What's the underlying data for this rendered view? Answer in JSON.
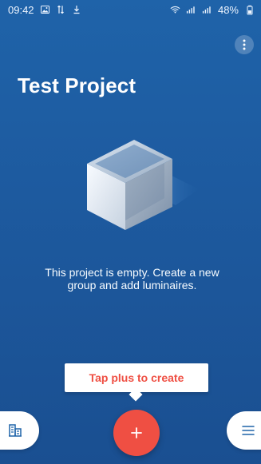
{
  "status_bar": {
    "time": "09:42",
    "battery": "48%"
  },
  "project": {
    "title": "Test Project",
    "empty_message": "This project is empty. Create a new group and add luminaires."
  },
  "actions": {
    "tooltip": "Tap plus to create",
    "more_icon": "more-vertical-icon",
    "add_icon": "plus-icon",
    "left_icon": "building-icon",
    "right_icon": "menu-icon"
  },
  "colors": {
    "background_top": "#1f63a9",
    "background_bottom": "#1a4f91",
    "accent": "#ef4f43",
    "white": "#ffffff"
  }
}
